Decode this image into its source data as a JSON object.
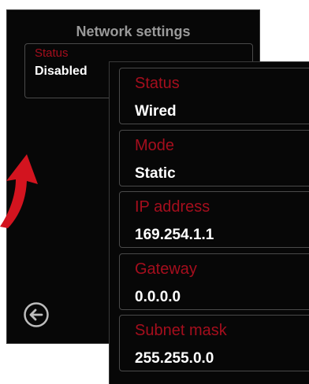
{
  "back_panel": {
    "title": "Network settings",
    "status_label": "Status",
    "status_value": "Disabled"
  },
  "front_panel": {
    "fields": [
      {
        "label": "Status",
        "value": "Wired"
      },
      {
        "label": "Mode",
        "value": "Static"
      },
      {
        "label": "IP address",
        "value": "169.254.1.1"
      },
      {
        "label": "Gateway",
        "value": "0.0.0.0"
      },
      {
        "label": "Subnet mask",
        "value": "255.255.0.0"
      }
    ]
  },
  "icons": {
    "back": "back-arrow-icon",
    "decor": "red-curved-arrow-icon"
  },
  "colors": {
    "panel_bg": "#070707",
    "label": "#a50e1d",
    "value": "#ffffff",
    "title": "#9a9a9a",
    "border": "#4a4a4a",
    "arrow": "#d3141f"
  }
}
